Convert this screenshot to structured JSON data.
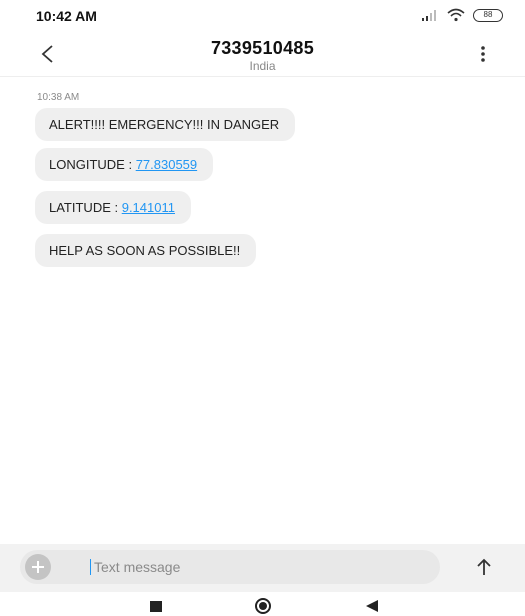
{
  "status_bar": {
    "time": "10:42 AM",
    "battery": "88",
    "icons": [
      "signal-icon",
      "wifi-icon",
      "battery-icon"
    ]
  },
  "header": {
    "title": "7339510485",
    "subtitle": "India",
    "back_icon": "chevron-left-icon",
    "more_icon": "more-vertical-icon"
  },
  "conversation": {
    "timestamp": "10:38 AM",
    "messages": [
      {
        "text": "ALERT!!!! EMERGENCY!!! IN DANGER"
      },
      {
        "label": "LONGITUDE : ",
        "link": "77.830559"
      },
      {
        "label": "LATITUDE : ",
        "link": "9.141011"
      },
      {
        "text": "HELP AS SOON AS POSSIBLE!!"
      }
    ]
  },
  "compose": {
    "placeholder": "Text message",
    "value": "",
    "add_icon": "plus-icon",
    "send_icon": "arrow-up-icon"
  },
  "nav_bar": {
    "icons": [
      "recents-icon",
      "home-icon",
      "back-icon"
    ]
  },
  "colors": {
    "link": "#2196f3",
    "bubble": "#efefef",
    "compose_bg": "#f2f2f2"
  }
}
